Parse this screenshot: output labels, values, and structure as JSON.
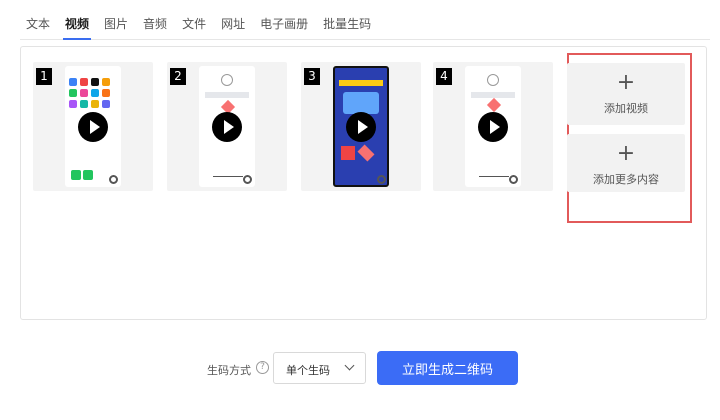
{
  "tabs": [
    {
      "label": "文本"
    },
    {
      "label": "视频",
      "active": true
    },
    {
      "label": "图片"
    },
    {
      "label": "音频"
    },
    {
      "label": "文件"
    },
    {
      "label": "网址"
    },
    {
      "label": "电子画册"
    },
    {
      "label": "批量生码"
    }
  ],
  "videos": [
    {
      "index": "1"
    },
    {
      "index": "2"
    },
    {
      "index": "3"
    },
    {
      "index": "4"
    }
  ],
  "add_buttons": {
    "add_video_label": "添加视频",
    "add_more_label": "添加更多内容",
    "plus": "+"
  },
  "footer": {
    "mode_label": "生码方式",
    "help": "?",
    "select_value": "单个生码",
    "generate_label": "立即生成二维码"
  },
  "colors": {
    "accent": "#3b6cf6",
    "highlight_border": "#e25a5a"
  }
}
